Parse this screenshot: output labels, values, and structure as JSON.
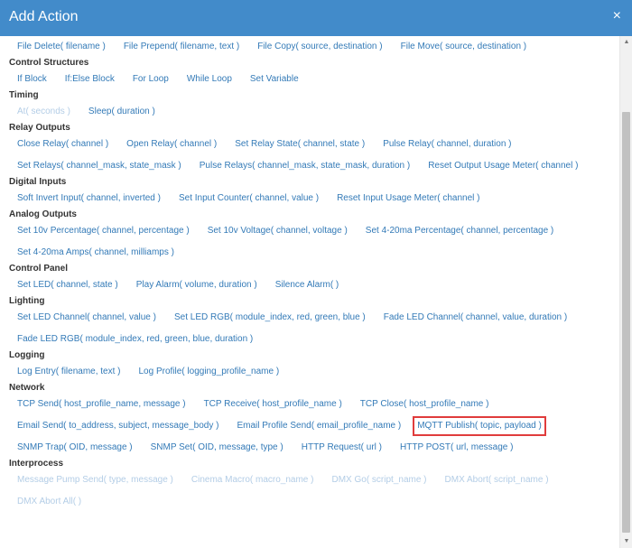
{
  "dialog": {
    "title": "Add Action",
    "close_glyph": "×"
  },
  "sections": [
    {
      "title": "",
      "actions": [
        {
          "label": "File Delete( filename )"
        },
        {
          "label": "File Prepend( filename, text )"
        },
        {
          "label": "File Copy( source, destination )"
        },
        {
          "label": "File Move( source, destination )"
        }
      ]
    },
    {
      "title": "Control Structures",
      "actions": [
        {
          "label": "If Block"
        },
        {
          "label": "If:Else Block"
        },
        {
          "label": "For Loop"
        },
        {
          "label": "While Loop"
        },
        {
          "label": "Set Variable"
        }
      ]
    },
    {
      "title": "Timing",
      "actions": [
        {
          "label": "At( seconds )",
          "disabled": true
        },
        {
          "label": "Sleep( duration )"
        }
      ]
    },
    {
      "title": "Relay Outputs",
      "actions": [
        {
          "label": "Close Relay( channel )"
        },
        {
          "label": "Open Relay( channel )"
        },
        {
          "label": "Set Relay State( channel, state )"
        },
        {
          "label": "Pulse Relay( channel, duration )"
        },
        {
          "label": "Set Relays( channel_mask, state_mask )"
        },
        {
          "label": "Pulse Relays( channel_mask, state_mask, duration )"
        },
        {
          "label": "Reset Output Usage Meter( channel )"
        }
      ]
    },
    {
      "title": "Digital Inputs",
      "actions": [
        {
          "label": "Soft Invert Input( channel, inverted )"
        },
        {
          "label": "Set Input Counter( channel, value )"
        },
        {
          "label": "Reset Input Usage Meter( channel )"
        }
      ]
    },
    {
      "title": "Analog Outputs",
      "actions": [
        {
          "label": "Set 10v Percentage( channel, percentage )"
        },
        {
          "label": "Set 10v Voltage( channel, voltage )"
        },
        {
          "label": "Set 4-20ma Percentage( channel, percentage )"
        },
        {
          "label": "Set 4-20ma Amps( channel, milliamps )"
        }
      ]
    },
    {
      "title": "Control Panel",
      "actions": [
        {
          "label": "Set LED( channel, state )"
        },
        {
          "label": "Play Alarm( volume, duration )"
        },
        {
          "label": "Silence Alarm( )"
        }
      ]
    },
    {
      "title": "Lighting",
      "actions": [
        {
          "label": "Set LED Channel( channel, value )"
        },
        {
          "label": "Set LED RGB( module_index, red, green, blue )"
        },
        {
          "label": "Fade LED Channel( channel, value, duration )"
        },
        {
          "label": "Fade LED RGB( module_index, red, green, blue, duration )"
        }
      ]
    },
    {
      "title": "Logging",
      "actions": [
        {
          "label": "Log Entry( filename, text )"
        },
        {
          "label": "Log Profile( logging_profile_name )"
        }
      ]
    },
    {
      "title": "Network",
      "actions": [
        {
          "label": "TCP Send( host_profile_name, message )"
        },
        {
          "label": "TCP Receive( host_profile_name )"
        },
        {
          "label": "TCP Close( host_profile_name )"
        },
        {
          "label": "Email Send( to_address, subject, message_body )"
        },
        {
          "label": "Email Profile Send( email_profile_name )"
        },
        {
          "label": "MQTT Publish( topic, payload )",
          "highlight": true
        },
        {
          "label": "SNMP Trap( OID, message )"
        },
        {
          "label": "SNMP Set( OID, message, type )"
        },
        {
          "label": "HTTP Request( url )"
        },
        {
          "label": "HTTP POST( url, message )"
        }
      ]
    },
    {
      "title": "Interprocess",
      "actions": [
        {
          "label": "Message Pump Send( type, message )",
          "disabled": true
        },
        {
          "label": "Cinema Macro( macro_name )",
          "disabled": true
        },
        {
          "label": "DMX Go( script_name )",
          "disabled": true
        },
        {
          "label": "DMX Abort( script_name )",
          "disabled": true
        },
        {
          "label": "DMX Abort All( )",
          "disabled": true
        }
      ]
    }
  ],
  "scrollbar": {
    "up_glyph": "▲",
    "down_glyph": "▼"
  }
}
